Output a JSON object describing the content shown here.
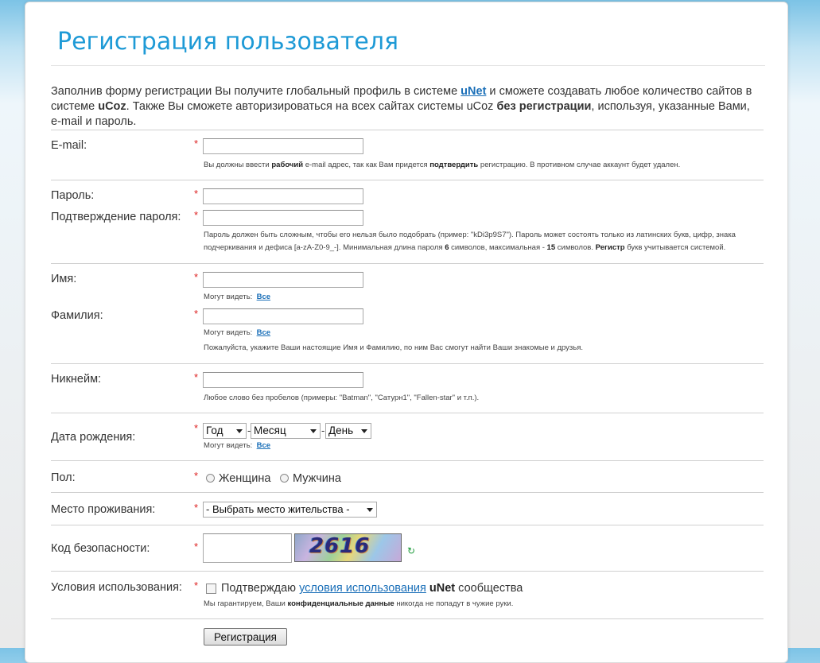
{
  "page": {
    "title": "Регистрация пользователя",
    "intro": {
      "t1": "Заполнив форму регистрации Вы получите глобальный профиль в системе ",
      "unet_link": "uNet",
      "t2": " и сможете создавать любое количество сайтов в системе ",
      "ucoz": "uCoz",
      "t3": ". Также Вы сможете авторизироваться на всех сайтах системы uCoz ",
      "no_reg": "без регистрации",
      "t4": ", используя, указанные Вами, e-mail и пароль."
    }
  },
  "required_mark": "*",
  "email": {
    "label": "E-mail:",
    "value": "",
    "hint_t1": "Вы должны ввести ",
    "hint_b1": "рабочий",
    "hint_t2": " e-mail адрес, так как Вам придется ",
    "hint_b2": "подтвердить",
    "hint_t3": " регистрацию. В противном случае аккаунт будет удален."
  },
  "password": {
    "label": "Пароль:",
    "confirm_label": "Подтверждение пароля:",
    "hint_line1": "Пароль должен быть сложным, чтобы его нельзя было подобрать (пример: \"kDi3p9S7\"). Пароль может состоять только из латинских букв, цифр, знака",
    "hint_l2_t1": "подчеркивания и дефиса [a-zA-Z0-9_-]. Минимальная длина пароля ",
    "hint_l2_b1": "6",
    "hint_l2_t2": " символов, максимальная - ",
    "hint_l2_b2": "15",
    "hint_l2_t3": " символов. ",
    "hint_l2_b3": "Регистр",
    "hint_l2_t4": " букв учитывается системой."
  },
  "visibility": {
    "label": "Могут видеть:",
    "value": "Все"
  },
  "first_name": {
    "label": "Имя:"
  },
  "last_name": {
    "label": "Фамилия:",
    "hint": "Пожалуйста, укажите Ваши настоящие Имя и Фамилию, по ним Вас смогут найти Ваши знакомые и друзья."
  },
  "nickname": {
    "label": "Никнейм:",
    "hint": "Любое слово без пробелов (примеры: \"Batman\", \"Сатурн1\", \"Fallen-star\" и т.п.)."
  },
  "birthdate": {
    "label": "Дата рождения:",
    "year": "Год",
    "month": "Месяц",
    "day": "День",
    "dash": "-"
  },
  "gender": {
    "label": "Пол:",
    "female": "Женщина",
    "male": "Мужчина"
  },
  "residence": {
    "label": "Место проживания:",
    "selected": "- Выбрать место жительства -"
  },
  "captcha": {
    "label": "Код безопасности:",
    "image_text": "2616"
  },
  "terms": {
    "label": "Условия использования:",
    "t1": "Подтверждаю ",
    "link": "условия использования",
    "t2": " ",
    "unet": "uNet",
    "t3": " сообщества",
    "hint_t1": "Мы гарантируем, Ваши ",
    "hint_b1": "конфиденциальные данные",
    "hint_t2": " никогда не попадут в чужие руки."
  },
  "submit_label": "Регистрация",
  "colors": {
    "title": "#1e9ad6",
    "link": "#1a6fb8",
    "required": "#dd2222"
  },
  "icons": {
    "refresh": "refresh-icon"
  }
}
